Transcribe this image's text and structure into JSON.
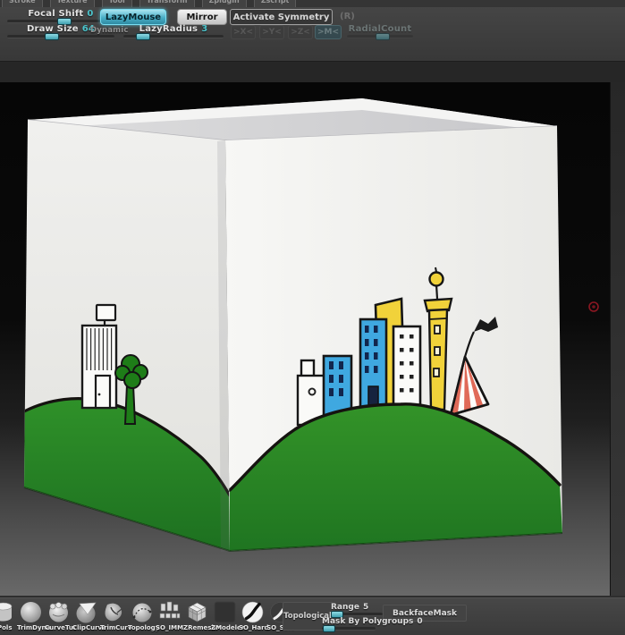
{
  "menu_tabs": [
    "Stroke",
    "Texture",
    "Tool",
    "Transform",
    "Zplugin",
    "Zscript"
  ],
  "top_toolbar": {
    "focal_shift_label": "Focal Shift",
    "focal_shift_value": "0",
    "draw_size_label": "Draw Size",
    "draw_size_value": "64",
    "dynamic_label": "Dynamic",
    "lazymouse_label": "LazyMouse",
    "mirror_label": "Mirror",
    "lazy_radius_label": "LazyRadius",
    "lazy_radius_value": "3",
    "activate_symmetry_label": "Activate Symmetry",
    "r_indicator": "(R)",
    "sym_x": ">X<",
    "sym_y": ">Y<",
    "sym_z": ">Z<",
    "sym_m": ">M<",
    "radial_count_label": "RadialCount"
  },
  "bottom_toolbar": {
    "brushes": [
      {
        "label": "_Pols"
      },
      {
        "label": "TrimDyna"
      },
      {
        "label": "CurveTut"
      },
      {
        "label": "ClipCurve"
      },
      {
        "label": "TrimCurv"
      },
      {
        "label": "Topology"
      },
      {
        "label": "SO_IMM"
      },
      {
        "label": "ZRemeshr"
      },
      {
        "label": "ZModeler"
      },
      {
        "label": "SO_Hard"
      },
      {
        "label": "SO_Soft"
      }
    ],
    "topological_label": "Topological",
    "range_label": "Range",
    "range_value": "5",
    "backface_mask_label": "BackfaceMask",
    "mask_by_polygroups_label": "Mask By Polygroups",
    "mask_by_polygroups_value": "0"
  },
  "colors": {
    "accent_teal": "#4cc4cc",
    "lazymouse_highlight": "#6fd0e4",
    "hill_green": "#2f9029",
    "tree_green": "#1e7d18",
    "building_blue": "#3fa8e0",
    "building_yellow": "#f1d23a",
    "tent_red": "#e06a58",
    "cursor_red": "#8c1722",
    "toolbar_bg": "#3c3c3c",
    "canvas_top": "#060606",
    "canvas_bottom": "#696969"
  }
}
